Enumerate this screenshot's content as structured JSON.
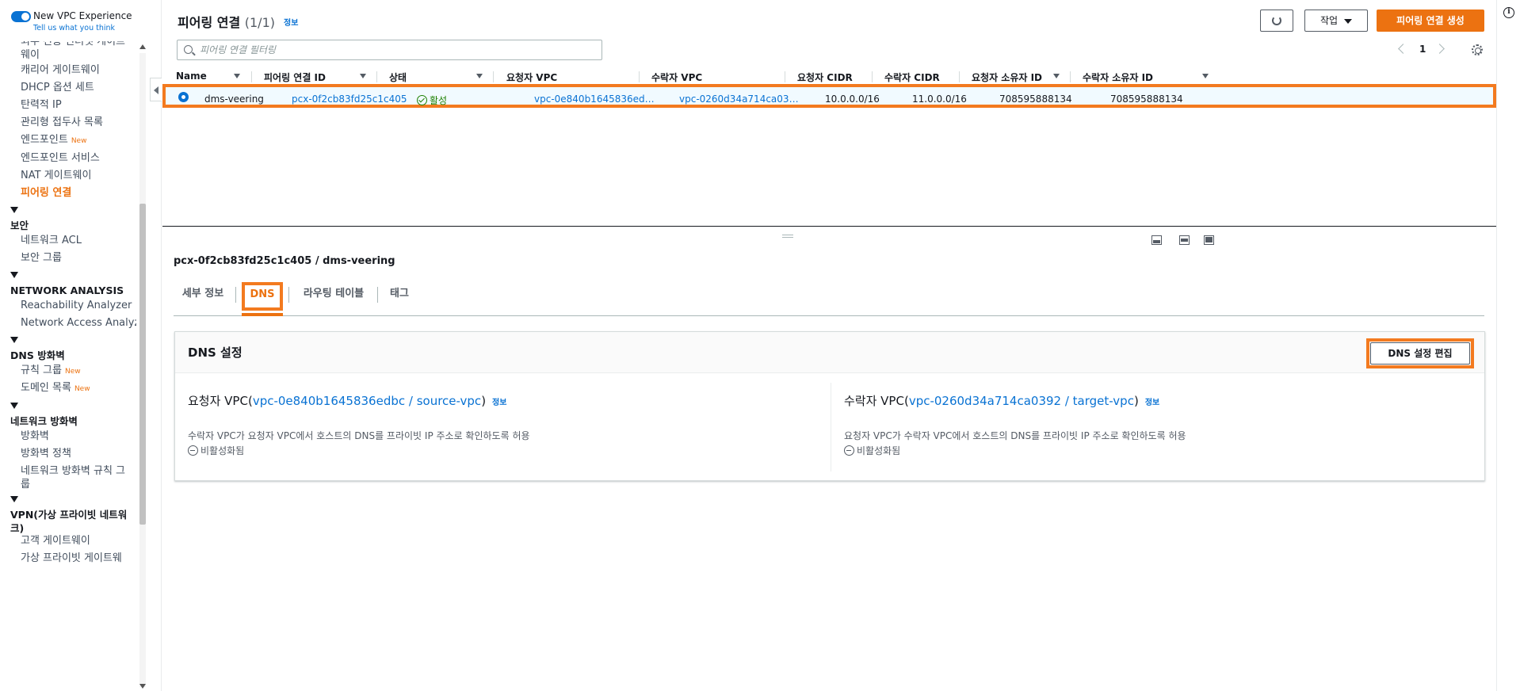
{
  "sidebar": {
    "toggle_label": "New VPC Experience",
    "feedback_link": "Tell us what you think",
    "items": {
      "egress_igw": "외부 전용 인터넷 게이트웨이",
      "carrier_gw": "캐리어 게이트웨이",
      "dhcp_options": "DHCP 옵션 세트",
      "elastic_ip": "탄력적 IP",
      "managed_prefix": "관리형 접두사 목록",
      "endpoints": "엔드포인트",
      "endpoint_services": "엔드포인트 서비스",
      "nat_gw": "NAT 게이트웨이",
      "peering": "피어링 연결",
      "network_acl": "네트워크 ACL",
      "security_groups": "보안 그룹",
      "reachability": "Reachability Analyzer",
      "network_access": "Network Access Analyzer",
      "rule_groups": "규칙 그룹",
      "domain_lists": "도메인 목록",
      "firewalls": "방화벽",
      "firewall_policies": "방화벽 정책",
      "fw_rule_groups": "네트워크 방화벽 규칙 그룹",
      "customer_gw": "고객 게이트웨이",
      "virtual_private_gw": "가상 프라이빗 게이트웨"
    },
    "new_badge": "New",
    "sections": {
      "security": "보안",
      "network_analysis": "NETWORK ANALYSIS",
      "dns_firewall": "DNS 방화벽",
      "network_firewall": "네트워크 방화벽",
      "vpn": "VPN(가상 프라이빗 네트워크)"
    }
  },
  "header": {
    "title": "피어링 연결",
    "count": "(1/1)",
    "info": "정보",
    "actions_label": "작업",
    "create_label": "피어링 연결 생성"
  },
  "search": {
    "placeholder": "피어링 연결 필터링",
    "value": ""
  },
  "pagination": {
    "current_page": "1"
  },
  "table": {
    "columns": [
      "Name",
      "피어링 연결 ID",
      "상태",
      "요청자 VPC",
      "수락자 VPC",
      "요청자 CIDR",
      "수락자 CIDR",
      "요청자 소유자 ID",
      "수락자 소유자 ID"
    ],
    "rows": [
      {
        "name": "dms-veering",
        "id": "pcx-0f2cb83fd25c1c405",
        "status": "활성",
        "requester_vpc": "vpc-0e840b1645836edbc / so...",
        "accepter_vpc": "vpc-0260d34a714ca0392 / tar...",
        "requester_cidr": "10.0.0.0/16",
        "accepter_cidr": "11.0.0.0/16",
        "requester_owner": "708595888134",
        "accepter_owner": "708595888134"
      }
    ]
  },
  "details": {
    "title": "pcx-0f2cb83fd25c1c405 / dms-veering",
    "tabs": [
      "세부 정보",
      "DNS",
      "라우팅 테이블",
      "태그"
    ],
    "dns": {
      "title": "DNS 설정",
      "edit_label": "DNS 설정 편집",
      "info": "정보",
      "requester": {
        "prefix": "요청자 VPC(",
        "vpc_link": "vpc-0e840b1645836edbc / source-vpc",
        "suffix": ")",
        "description": "수락자 VPC가 요청자 VPC에서 호스트의 DNS를 프라이빗 IP 주소로 확인하도록 허용",
        "status": "비활성화됨"
      },
      "accepter": {
        "prefix": "수락자 VPC(",
        "vpc_link": "vpc-0260d34a714ca0392 / target-vpc",
        "suffix": ")",
        "description": "요청자 VPC가 수락자 VPC에서 호스트의 DNS를 프라이빗 IP 주소로 확인하도록 허용",
        "status": "비활성화됨"
      }
    }
  },
  "colors": {
    "accent": "#ec7211",
    "highlight": "#f37a1f",
    "link": "#0972d3",
    "success": "#1d8102"
  }
}
